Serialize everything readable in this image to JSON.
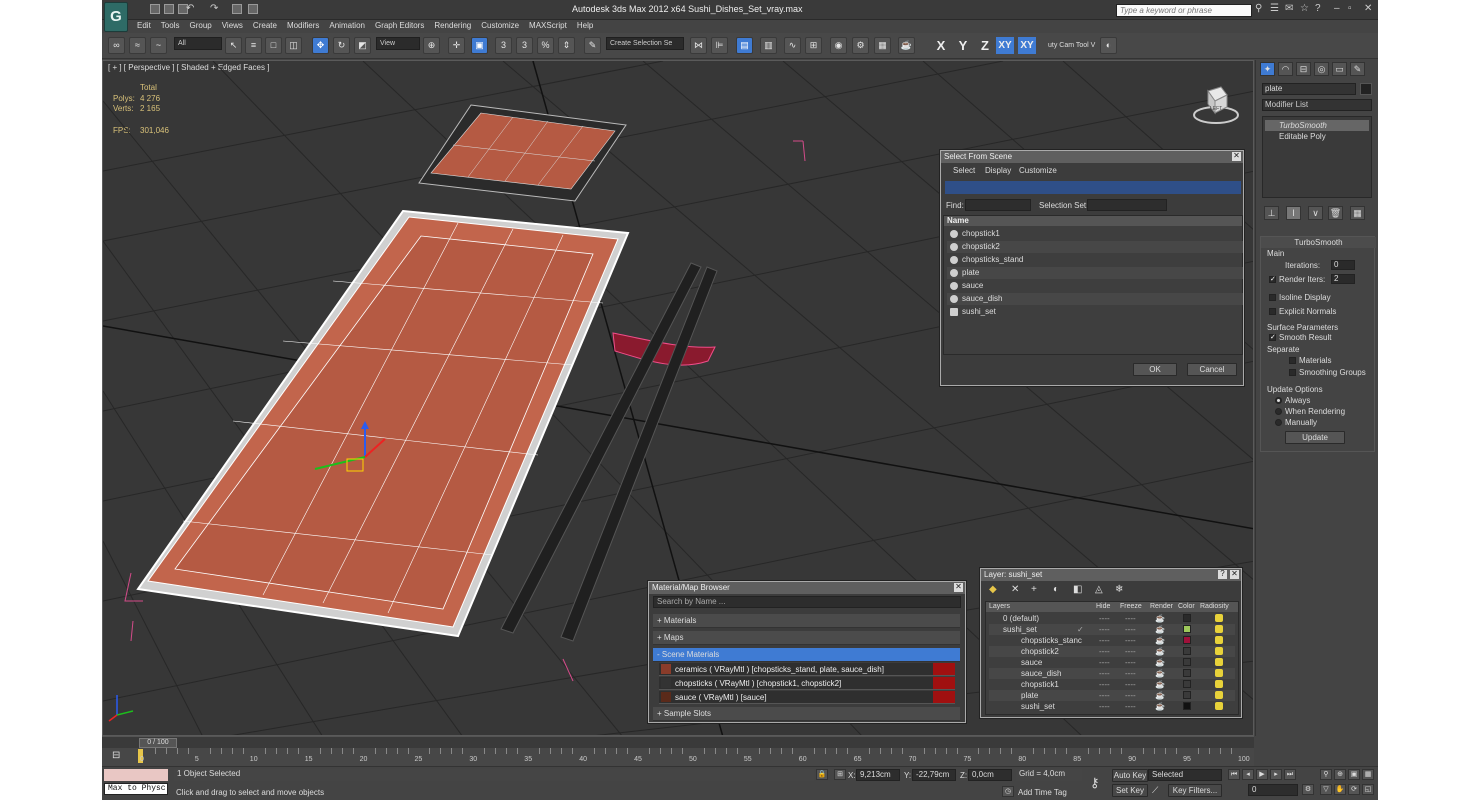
{
  "app": {
    "title": "Autodesk 3ds Max  2012 x64     Sushi_Dishes_Set_vray.max",
    "logo": "3ds-max-logo",
    "search_placeholder": "Type a keyword or phrase"
  },
  "menu": [
    "Edit",
    "Tools",
    "Group",
    "Views",
    "Create",
    "Modifiers",
    "Animation",
    "Graph Editors",
    "Rendering",
    "Customize",
    "MAXScript",
    "Help"
  ],
  "toolbar": {
    "selection_filter": "All",
    "ref_coord": "View",
    "snap_label": "3",
    "angle_snap_label": "3",
    "percent_snap_label": "%",
    "named_selection": "Create Selection Se",
    "axis_constraints": [
      "X",
      "Y",
      "Z",
      "XY",
      "XY"
    ],
    "utility_label": "uty Cam Tool V"
  },
  "viewport": {
    "label": "[ + ] [ Perspective ] [ Shaded + Edged Faces ]",
    "stats": {
      "total_label": "Total",
      "polys_label": "Polys:",
      "polys": "4 276",
      "verts_label": "Verts:",
      "verts": "2 165",
      "fps_label": "FPS:",
      "fps": "301,046"
    },
    "viewcube_label": "LEFT"
  },
  "command_panel": {
    "object_name": "plate",
    "modifier_list": "Modifier List",
    "stack": [
      "TurboSmooth",
      "Editable Poly"
    ],
    "turbosmooth": {
      "title": "TurboSmooth",
      "main": "Main",
      "iterations_label": "Iterations:",
      "iterations": "0",
      "render_iters_label": "Render Iters:",
      "render_iters": "2",
      "isoline": "Isoline Display",
      "explicit": "Explicit Normals",
      "surface_params": "Surface Parameters",
      "smooth_result": "Smooth Result",
      "separate": "Separate",
      "materials": "Materials",
      "smoothing_groups": "Smoothing Groups",
      "update_options": "Update Options",
      "always": "Always",
      "when_rendering": "When Rendering",
      "manually": "Manually",
      "update_button": "Update"
    }
  },
  "select_from_scene": {
    "title": "Select From Scene",
    "menu": [
      "Select",
      "Display",
      "Customize"
    ],
    "find_label": "Find:",
    "selection_set_label": "Selection Set:",
    "column_name": "Name",
    "items": [
      "chopstick1",
      "chopstick2",
      "chopsticks_stand",
      "plate",
      "sauce",
      "sauce_dish",
      "sushi_set"
    ],
    "ok": "OK",
    "cancel": "Cancel"
  },
  "material_browser": {
    "title": "Material/Map Browser",
    "search_placeholder": "Search by Name ...",
    "groups": [
      "+ Materials",
      "+ Maps",
      "- Scene Materials",
      "+ Sample Slots"
    ],
    "scene_materials": [
      "ceramics  ( VRayMtl ) [chopsticks_stand, plate, sauce_dish]",
      "chopsticks  ( VRayMtl ) [chopstick1, chopstick2]",
      "sauce  ( VRayMtl ) [sauce]"
    ]
  },
  "layer_dialog": {
    "title": "Layer: sushi_set",
    "help": "?",
    "columns": [
      "Layers",
      "Hide",
      "Freeze",
      "Render",
      "Color",
      "Radiosity"
    ],
    "rows": [
      {
        "name": "0 (default)",
        "color": "#2a2a2a",
        "indent": 1
      },
      {
        "name": "sushi_set",
        "color": "#9ec85a",
        "indent": 1
      },
      {
        "name": "chopsticks_stanc",
        "color": "#a0103a",
        "indent": 2
      },
      {
        "name": "chopstick2",
        "color": "#3a3a3a",
        "indent": 2
      },
      {
        "name": "sauce",
        "color": "#3a3a3a",
        "indent": 2
      },
      {
        "name": "sauce_dish",
        "color": "#3a3a3a",
        "indent": 2
      },
      {
        "name": "chopstick1",
        "color": "#3a3a3a",
        "indent": 2
      },
      {
        "name": "plate",
        "color": "#3a3a3a",
        "indent": 2
      },
      {
        "name": "sushi_set",
        "color": "#111111",
        "indent": 2
      }
    ]
  },
  "timeline": {
    "frame": "0 / 100",
    "ticks": [
      "0",
      "5",
      "10",
      "15",
      "20",
      "25",
      "30",
      "35",
      "40",
      "45",
      "50",
      "55",
      "60",
      "65",
      "70",
      "75",
      "80",
      "85",
      "90",
      "95",
      "100"
    ]
  },
  "status": {
    "listener": "Max to Physc",
    "selection": "1 Object Selected",
    "prompt": "Click and drag to select and move objects",
    "x_label": "X:",
    "x": "9,213cm",
    "y_label": "Y:",
    "y": "-22,79cm",
    "z_label": "Z:",
    "z": "0,0cm",
    "grid": "Grid = 4,0cm",
    "add_time_tag": "Add Time Tag",
    "auto_key": "Auto Key",
    "set_key": "Set Key",
    "selected": "Selected",
    "key_filters": "Key Filters...",
    "frame": "0"
  },
  "colors": {
    "accent": "#3f7bd3",
    "plate_fill": "#c2654c",
    "material_red": "#a01010",
    "viewport_bg": "#373737"
  }
}
